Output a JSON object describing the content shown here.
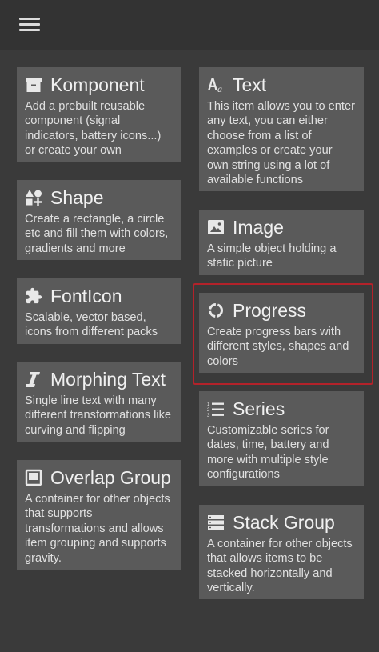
{
  "menu": {
    "icon": "hamburger-menu-icon"
  },
  "left_column": [
    {
      "id": "komponent",
      "icon": "archive-box-icon",
      "title": "Komponent",
      "desc": "Add a prebuilt reusable component (signal indicators, battery icons...) or create your own"
    },
    {
      "id": "shape",
      "icon": "shapes-icon",
      "title": "Shape",
      "desc": "Create a rectangle, a circle etc and fill them with colors, gradients and more"
    },
    {
      "id": "fonticon",
      "icon": "puzzle-piece-icon",
      "title": "FontIcon",
      "desc": "Scalable, vector based, icons from different packs"
    },
    {
      "id": "morphing-text",
      "icon": "italic-text-icon",
      "title": "Morphing Text",
      "desc": "Single line text with many different transformations like curving and flipping"
    },
    {
      "id": "overlap-group",
      "icon": "overlap-frame-icon",
      "title": "Overlap Group",
      "desc": "A container for other objects that supports transformations and allows item grouping and supports gravity."
    }
  ],
  "right_column": [
    {
      "id": "text",
      "icon": "text-format-icon",
      "title": "Text",
      "desc": "This item allows you to enter any text, you can either choose from a list of examples or create your own string using a lot of available functions"
    },
    {
      "id": "image",
      "icon": "image-icon",
      "title": "Image",
      "desc": "A simple object holding a static picture"
    },
    {
      "id": "progress",
      "icon": "progress-ring-icon",
      "title": "Progress",
      "desc": "Create progress bars with different styles, shapes and colors",
      "selected": true
    },
    {
      "id": "series",
      "icon": "numbered-list-icon",
      "title": "Series",
      "desc": "Customizable series for dates, time, battery and more with multiple style configurations"
    },
    {
      "id": "stack-group",
      "icon": "stack-layers-icon",
      "title": "Stack Group",
      "desc": "A container for other objects that allows items to be stacked horizontally and vertically."
    }
  ],
  "colors": {
    "background": "#3a3a3a",
    "card": "#5a5a5a",
    "selection": "#b3222a"
  }
}
